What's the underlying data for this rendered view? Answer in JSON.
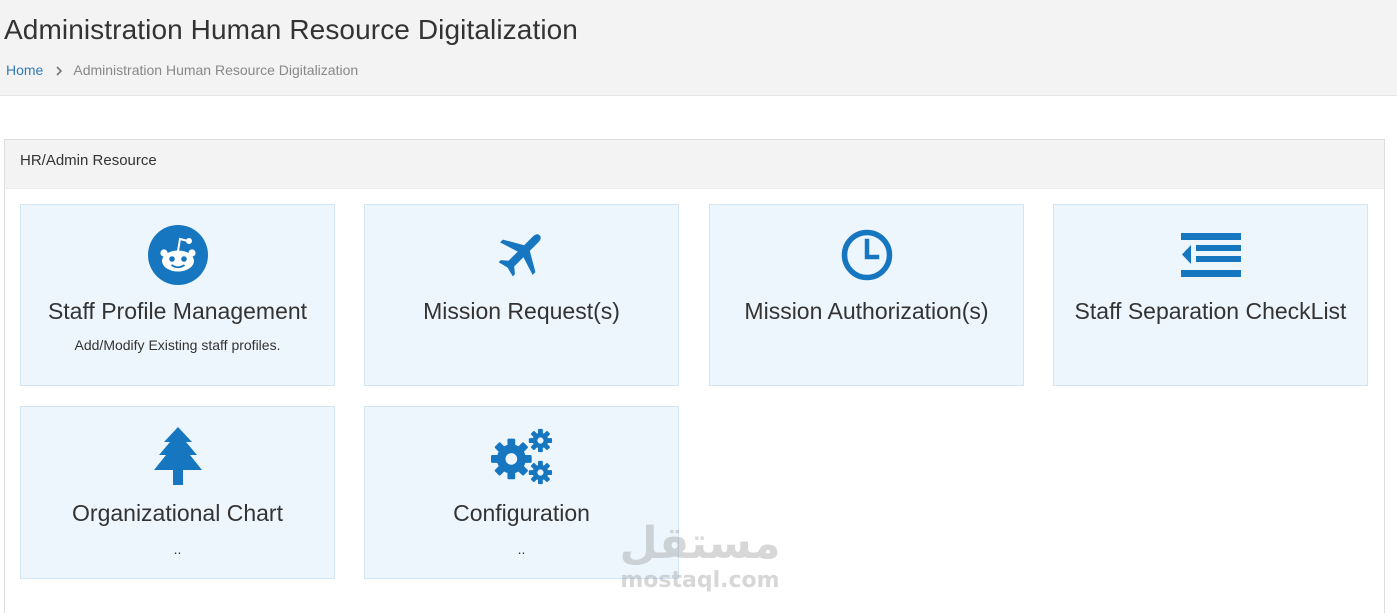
{
  "header": {
    "title": "Administration Human Resource Digitalization",
    "breadcrumb": {
      "home": "Home",
      "current": "Administration Human Resource Digitalization"
    }
  },
  "panel": {
    "heading": "HR/Admin Resource"
  },
  "tiles": [
    {
      "title": "Staff Profile Management",
      "description": "Add/Modify Existing staff profiles.",
      "icon": "reddit-icon"
    },
    {
      "title": "Mission Request(s)",
      "description": "",
      "icon": "plane-icon"
    },
    {
      "title": "Mission Authorization(s)",
      "description": "",
      "icon": "clock-icon"
    },
    {
      "title": "Staff Separation CheckList",
      "description": "",
      "icon": "indent-icon"
    },
    {
      "title": "Organizational Chart",
      "description": "..",
      "icon": "tree-icon"
    },
    {
      "title": "Configuration",
      "description": "..",
      "icon": "cogs-icon"
    }
  ],
  "watermark": {
    "arabic": "مستقل",
    "latin": "mostaql.com"
  },
  "colors": {
    "accent": "#1776c0",
    "link": "#337ab7",
    "tile_bg": "#eef6fd",
    "header_bg": "#f3f3f3"
  }
}
